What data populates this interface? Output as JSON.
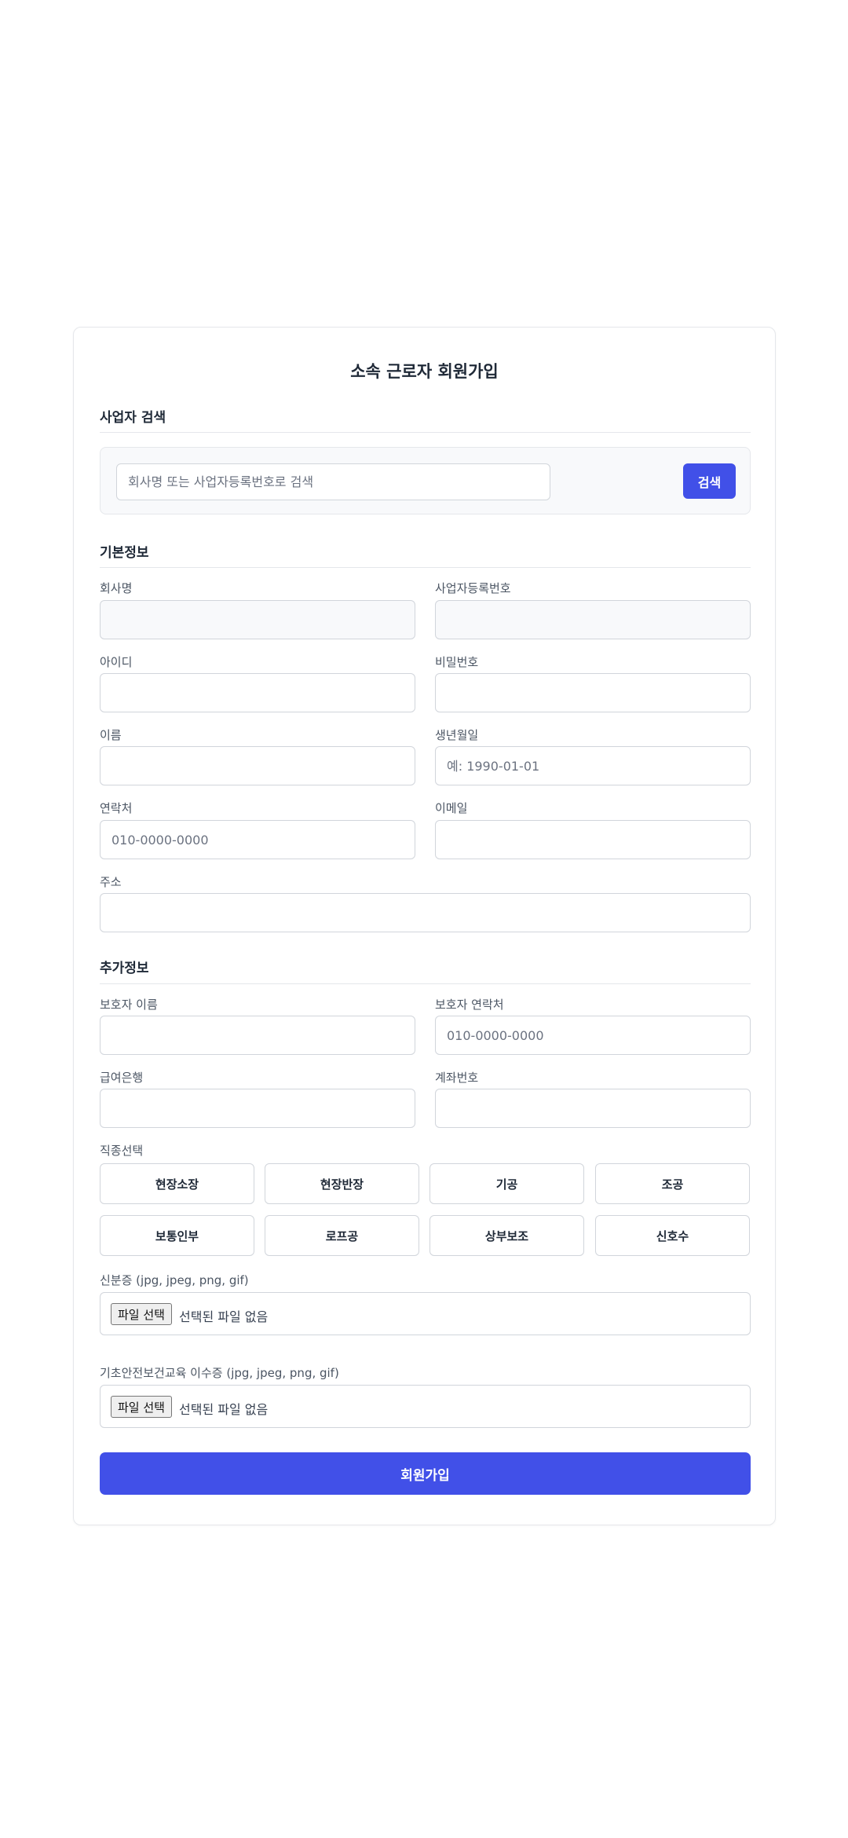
{
  "form": {
    "title": "소속 근로자 회원가입",
    "search_section": {
      "title": "사업자 검색",
      "placeholder": "회사명 또는 사업자등록번호로 검색",
      "button_label": "검색"
    },
    "basic_section": {
      "title": "기본정보",
      "company_name_label": "회사명",
      "biz_number_label": "사업자등록번호",
      "user_id_label": "아이디",
      "password_label": "비밀번호",
      "name_label": "이름",
      "birthdate_label": "생년월일",
      "birthdate_placeholder": "예: 1990-01-01",
      "phone_label": "연락처",
      "phone_placeholder": "010-0000-0000",
      "email_label": "이메일",
      "address_label": "주소"
    },
    "extra_section": {
      "title": "추가정보",
      "guardian_name_label": "보호자 이름",
      "guardian_phone_label": "보호자 연락처",
      "guardian_phone_placeholder": "010-0000-0000",
      "bank_label": "급여은행",
      "account_label": "계좌번호",
      "job_label": "직종선택",
      "jobs": [
        "현장소장",
        "현장반장",
        "기공",
        "조공",
        "보통인부",
        "로프공",
        "상부보조",
        "신호수"
      ],
      "id_card_label": "신분증 (jpg, jpeg, png, gif)",
      "safety_cert_label": "기초안전보건교육 이수증 (jpg, jpeg, png, gif)",
      "file_button_label": "파일 선택",
      "file_status": "선택된 파일 없음"
    },
    "submit_label": "회원가입"
  }
}
